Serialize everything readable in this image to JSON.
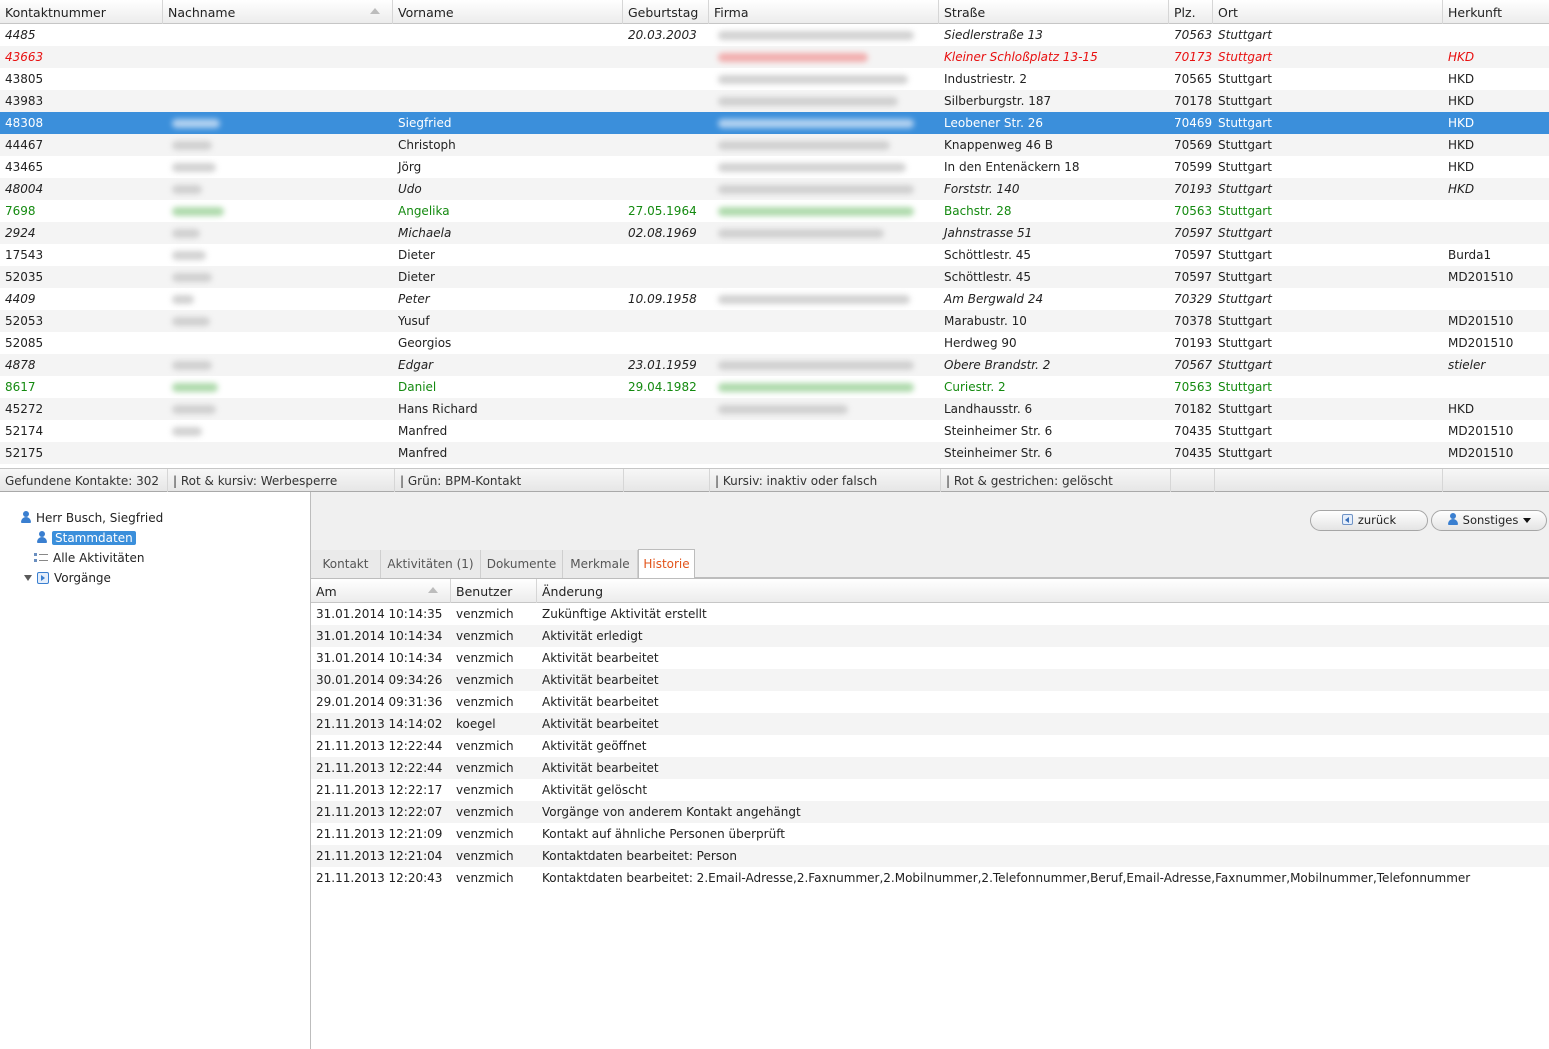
{
  "grid": {
    "columns": [
      "Kontaktnummer",
      "Nachname",
      "Vorname",
      "Geburtstag",
      "Firma",
      "Straße",
      "Plz.",
      "Ort",
      "Herkunft"
    ],
    "rows": [
      {
        "nr": "4485",
        "vorname": "",
        "geb": "20.03.2003",
        "strasse": "Siedlerstraße 13",
        "plz": "70563",
        "ort": "Stuttgart",
        "herkunft": "",
        "style": "italic"
      },
      {
        "nr": "43663",
        "vorname": "",
        "geb": "",
        "strasse": "Kleiner Schloßplatz 13-15",
        "plz": "70173",
        "ort": "Stuttgart",
        "herkunft": "HKD",
        "style": "red"
      },
      {
        "nr": "43805",
        "vorname": "",
        "geb": "",
        "strasse": "Industriestr. 2",
        "plz": "70565",
        "ort": "Stuttgart",
        "herkunft": "HKD",
        "style": "normal"
      },
      {
        "nr": "43983",
        "vorname": "",
        "geb": "",
        "strasse": "Silberburgstr. 187",
        "plz": "70178",
        "ort": "Stuttgart",
        "herkunft": "HKD",
        "style": "normal"
      },
      {
        "nr": "48308",
        "vorname": "Siegfried",
        "geb": "",
        "strasse": "Leobener Str. 26",
        "plz": "70469",
        "ort": "Stuttgart",
        "herkunft": "HKD",
        "style": "selected"
      },
      {
        "nr": "44467",
        "vorname": "Christoph",
        "geb": "",
        "strasse": "Knappenweg 46 B",
        "plz": "70569",
        "ort": "Stuttgart",
        "herkunft": "HKD",
        "style": "normal"
      },
      {
        "nr": "43465",
        "vorname": "Jörg",
        "geb": "",
        "strasse": "In den Entenäckern 18",
        "plz": "70599",
        "ort": "Stuttgart",
        "herkunft": "HKD",
        "style": "normal"
      },
      {
        "nr": "48004",
        "vorname": "Udo",
        "geb": "",
        "strasse": "Forststr. 140",
        "plz": "70193",
        "ort": "Stuttgart",
        "herkunft": "HKD",
        "style": "italic"
      },
      {
        "nr": "7698",
        "vorname": "Angelika",
        "geb": "27.05.1964",
        "strasse": "Bachstr. 28",
        "plz": "70563",
        "ort": "Stuttgart",
        "herkunft": "",
        "style": "green"
      },
      {
        "nr": "2924",
        "vorname": "Michaela",
        "geb": "02.08.1969",
        "strasse": "Jahnstrasse 51",
        "plz": "70597",
        "ort": "Stuttgart",
        "herkunft": "",
        "style": "italic"
      },
      {
        "nr": "17543",
        "vorname": "Dieter",
        "geb": "",
        "strasse": "Schöttlestr. 45",
        "plz": "70597",
        "ort": "Stuttgart",
        "herkunft": "Burda1",
        "style": "normal"
      },
      {
        "nr": "52035",
        "vorname": "Dieter",
        "geb": "",
        "strasse": "Schöttlestr. 45",
        "plz": "70597",
        "ort": "Stuttgart",
        "herkunft": "MD201510",
        "style": "normal"
      },
      {
        "nr": "4409",
        "vorname": "Peter",
        "geb": "10.09.1958",
        "strasse": "Am Bergwald 24",
        "plz": "70329",
        "ort": "Stuttgart",
        "herkunft": "",
        "style": "italic"
      },
      {
        "nr": "52053",
        "vorname": "Yusuf",
        "geb": "",
        "strasse": "Marabustr. 10",
        "plz": "70378",
        "ort": "Stuttgart",
        "herkunft": "MD201510",
        "style": "normal"
      },
      {
        "nr": "52085",
        "vorname": "Georgios",
        "geb": "",
        "strasse": "Herdweg 90",
        "plz": "70193",
        "ort": "Stuttgart",
        "herkunft": "MD201510",
        "style": "normal"
      },
      {
        "nr": "4878",
        "vorname": "Edgar",
        "geb": "23.01.1959",
        "strasse": "Obere Brandstr. 2",
        "plz": "70567",
        "ort": "Stuttgart",
        "herkunft": "stieler",
        "style": "italic"
      },
      {
        "nr": "8617",
        "vorname": "Daniel",
        "geb": "29.04.1982",
        "strasse": "Curiestr. 2",
        "plz": "70563",
        "ort": "Stuttgart",
        "herkunft": "",
        "style": "green"
      },
      {
        "nr": "45272",
        "vorname": "Hans Richard",
        "geb": "",
        "strasse": "Landhausstr. 6",
        "plz": "70182",
        "ort": "Stuttgart",
        "herkunft": "HKD",
        "style": "normal"
      },
      {
        "nr": "52174",
        "vorname": "Manfred",
        "geb": "",
        "strasse": "Steinheimer Str. 6",
        "plz": "70435",
        "ort": "Stuttgart",
        "herkunft": "MD201510",
        "style": "normal"
      },
      {
        "nr": "52175",
        "vorname": "Manfred",
        "geb": "",
        "strasse": "Steinheimer Str. 6",
        "plz": "70435",
        "ort": "Stuttgart",
        "herkunft": "MD201510",
        "style": "normal"
      }
    ]
  },
  "status": {
    "found": "Gefundene Kontakte: 302",
    "legend_red": "| Rot & kursiv: Werbesperre",
    "legend_green": "| Grün: BPM-Kontakt",
    "legend_italic": "| Kursiv: inaktiv oder falsch",
    "legend_strike": "| Rot & gestrichen: gelöscht"
  },
  "tree": {
    "person": "Herr Busch, Siegfried",
    "stammdaten": "Stammdaten",
    "aktivitaeten": "Alle Aktivitäten",
    "vorgaenge": "Vorgänge"
  },
  "buttons": {
    "back": "zurück",
    "more": "Sonstiges"
  },
  "tabs": [
    "Kontakt",
    "Aktivitäten (1)",
    "Dokumente",
    "Merkmale",
    "Historie"
  ],
  "history": {
    "columns": [
      "Am",
      "Benutzer",
      "Änderung"
    ],
    "rows": [
      {
        "am": "31.01.2014 10:14:35",
        "user": "venzmich",
        "change": "Zukünftige Aktivität erstellt"
      },
      {
        "am": "31.01.2014 10:14:34",
        "user": "venzmich",
        "change": "Aktivität erledigt"
      },
      {
        "am": "31.01.2014 10:14:34",
        "user": "venzmich",
        "change": "Aktivität bearbeitet"
      },
      {
        "am": "30.01.2014 09:34:26",
        "user": "venzmich",
        "change": "Aktivität bearbeitet"
      },
      {
        "am": "29.01.2014 09:31:36",
        "user": "venzmich",
        "change": "Aktivität bearbeitet"
      },
      {
        "am": "21.11.2013 14:14:02",
        "user": "koegel",
        "change": "Aktivität bearbeitet"
      },
      {
        "am": "21.11.2013 12:22:44",
        "user": "venzmich",
        "change": "Aktivität geöffnet"
      },
      {
        "am": "21.11.2013 12:22:44",
        "user": "venzmich",
        "change": "Aktivität bearbeitet"
      },
      {
        "am": "21.11.2013 12:22:17",
        "user": "venzmich",
        "change": "Aktivität gelöscht"
      },
      {
        "am": "21.11.2013 12:22:07",
        "user": "venzmich",
        "change": "Vorgänge von anderem Kontakt angehängt"
      },
      {
        "am": "21.11.2013 12:21:09",
        "user": "venzmich",
        "change": "Kontakt auf ähnliche Personen überprüft"
      },
      {
        "am": "21.11.2013 12:21:04",
        "user": "venzmich",
        "change": "Kontaktdaten bearbeitet: Person"
      },
      {
        "am": "21.11.2013 12:20:43",
        "user": "venzmich",
        "change": "Kontaktdaten bearbeitet: 2.Email-Adresse,2.Faxnummer,2.Mobilnummer,2.Telefonnummer,Beruf,Email-Adresse,Faxnummer,Mobilnummer,Telefonnummer"
      }
    ]
  },
  "colors": {
    "selection": "#3b8fdb",
    "red": "#e81010",
    "green": "#148a10",
    "active_tab": "#e2541b"
  }
}
